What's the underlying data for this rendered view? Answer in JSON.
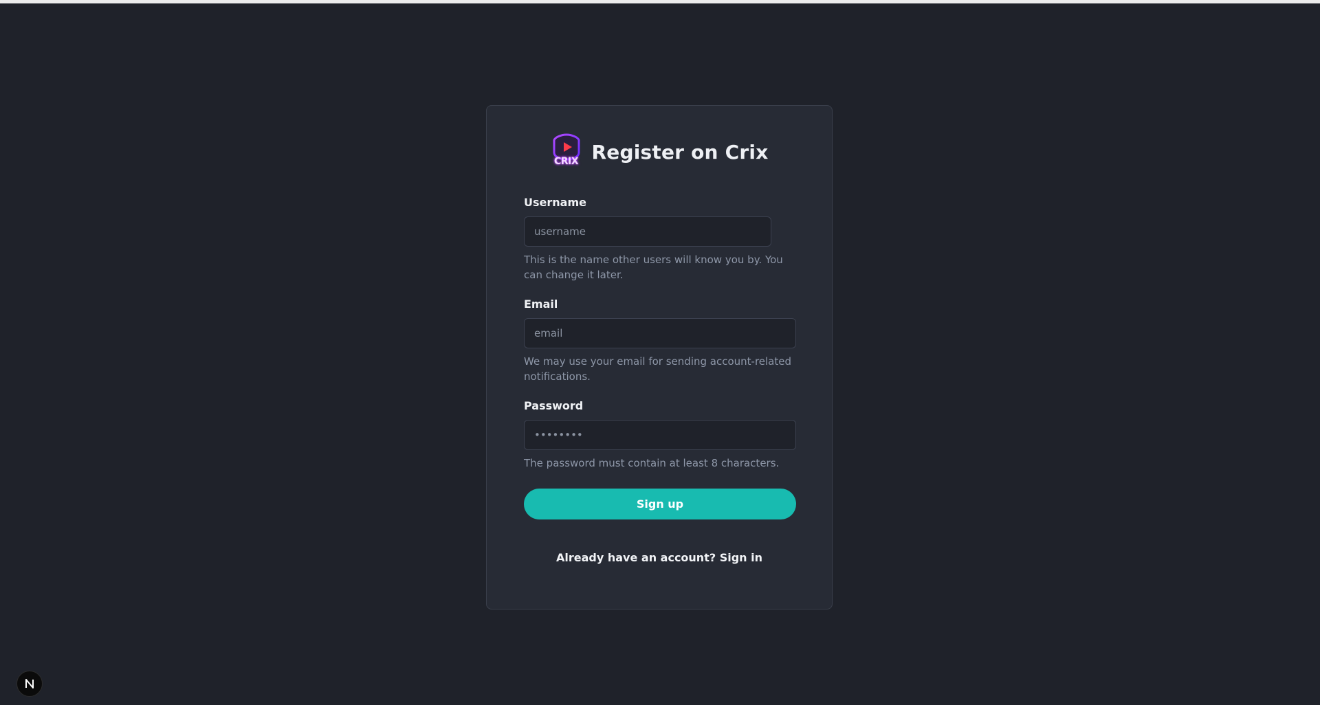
{
  "page": {
    "title": "Register on Crix",
    "logo_text": "CRIX"
  },
  "form": {
    "username": {
      "label": "Username",
      "placeholder": "username",
      "help": "This is the name other users will know you by. You can change it later."
    },
    "email": {
      "label": "Email",
      "placeholder": "email",
      "help": "We may use your email for sending account-related notifications."
    },
    "password": {
      "label": "Password",
      "placeholder": "••••••••",
      "help": "The password must contain at least 8 characters."
    },
    "submit_label": "Sign up"
  },
  "footer": {
    "prompt": "Already have an account?",
    "link_label": "Sign in"
  },
  "badge": {
    "letter": "N"
  },
  "colors": {
    "background": "#1f222a",
    "card": "#272b35",
    "accent": "#18bbb0",
    "logo_purple": "#8a3cff",
    "logo_play": "#ff3b4a"
  }
}
